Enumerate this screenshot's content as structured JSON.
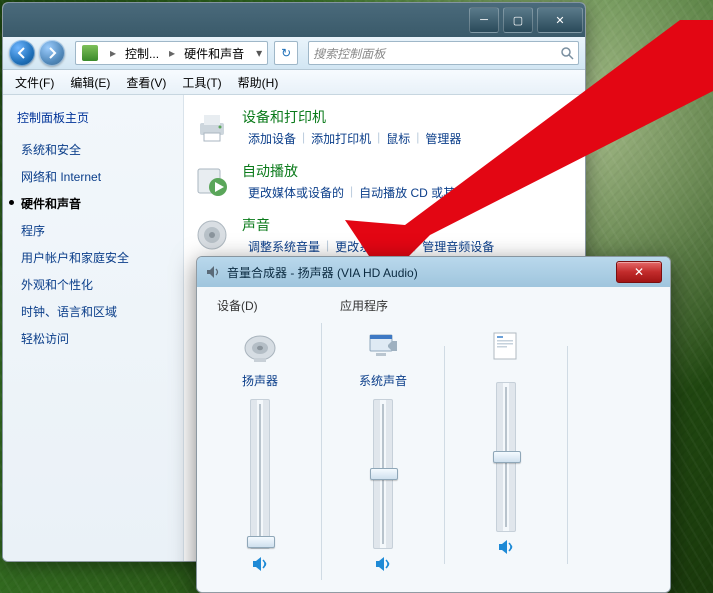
{
  "cp": {
    "breadcrumb": [
      "控制...",
      "硬件和声音"
    ],
    "search_placeholder": "搜索控制面板",
    "menus": [
      "文件(F)",
      "编辑(E)",
      "查看(V)",
      "工具(T)",
      "帮助(H)"
    ],
    "side_heading": "控制面板主页",
    "side": [
      "系统和安全",
      "网络和 Internet",
      "硬件和声音",
      "程序",
      "用户帐户和家庭安全",
      "外观和个性化",
      "时钟、语言和区域",
      "轻松访问"
    ],
    "cat": [
      {
        "title": "设备和打印机",
        "links": [
          "添加设备",
          "添加打印机",
          "鼠标",
          "管理器"
        ]
      },
      {
        "title": "自动播放",
        "links": [
          "更改媒体或设备的",
          "自动播放 CD 或其他媒体"
        ]
      },
      {
        "title": "声音",
        "links": [
          "调整系统音量",
          "更改系统声音",
          "管理音频设备"
        ]
      }
    ]
  },
  "mixer": {
    "title": "音量合成器 - 扬声器 (VIA HD Audio)",
    "section_device": "设备(D)",
    "section_apps": "应用程序",
    "channels": [
      {
        "name": "扬声器",
        "level_pct": 3
      },
      {
        "name": "系统声音",
        "level_pct": 50
      },
      {
        "name": "",
        "level_pct": 50
      }
    ]
  }
}
